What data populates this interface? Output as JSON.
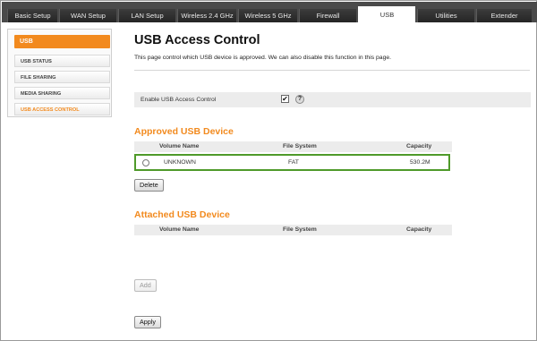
{
  "tabs": [
    {
      "label": "Basic Setup",
      "active": false
    },
    {
      "label": "WAN Setup",
      "active": false
    },
    {
      "label": "LAN Setup",
      "active": false
    },
    {
      "label": "Wireless 2.4 GHz",
      "active": false
    },
    {
      "label": "Wireless 5 GHz",
      "active": false
    },
    {
      "label": "Firewall",
      "active": false
    },
    {
      "label": "USB",
      "active": true
    },
    {
      "label": "Utilities",
      "active": false
    },
    {
      "label": "Extender",
      "active": false
    }
  ],
  "sidebar": {
    "header": "USB",
    "items": [
      {
        "label": "USB STATUS",
        "active": false
      },
      {
        "label": "FILE SHARING",
        "active": false
      },
      {
        "label": "MEDIA SHARING",
        "active": false
      },
      {
        "label": "USB ACCESS CONTROL",
        "active": true
      }
    ]
  },
  "page": {
    "title": "USB Access Control",
    "description": "This page control which USB device is approved. We can also disable this function in this page."
  },
  "enable": {
    "label": "Enable USB Access Control",
    "checked": true,
    "check_glyph": "✔",
    "help_glyph": "?"
  },
  "approved": {
    "title": "Approved USB Device",
    "columns": [
      "Volume Name",
      "File System",
      "Capacity"
    ],
    "rows": [
      {
        "volume": "UNKNOWN",
        "filesystem": "FAT",
        "capacity": "530.2M"
      }
    ],
    "delete_label": "Delete"
  },
  "attached": {
    "title": "Attached USB Device",
    "columns": [
      "Volume Name",
      "File System",
      "Capacity"
    ],
    "add_label": "Add"
  },
  "apply_label": "Apply",
  "colors": {
    "accent": "#f28a1e",
    "highlight": "#4f9a2a",
    "tabbar": "#4a4a4a"
  }
}
